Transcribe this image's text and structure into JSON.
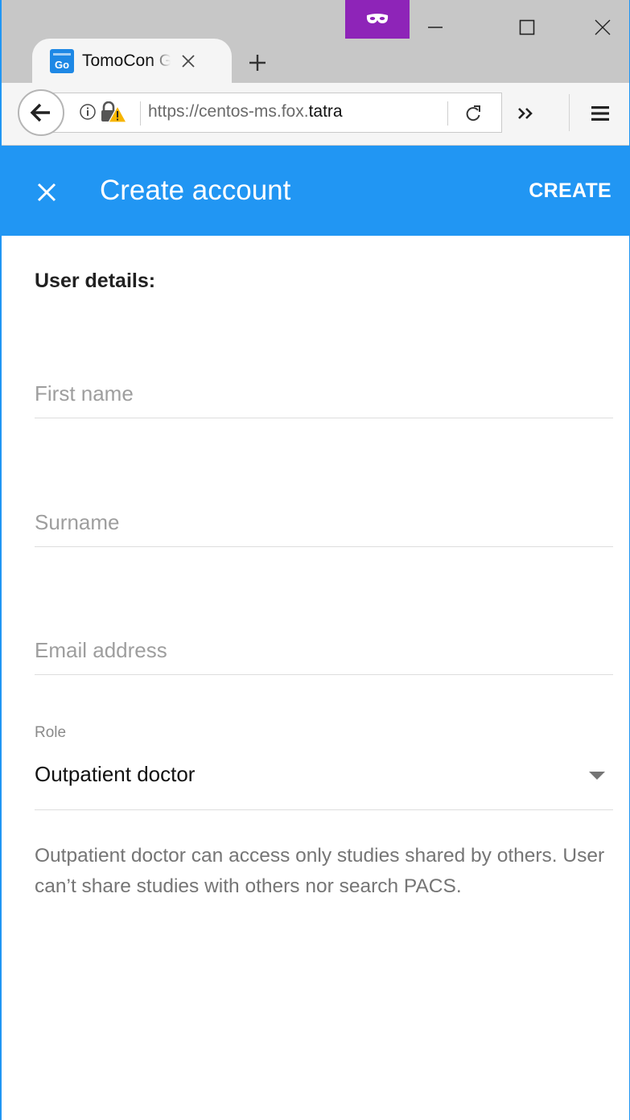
{
  "browser": {
    "tab": {
      "favicon_text": "Go",
      "title": "TomoCon GO",
      "title_visible": "TomoCon"
    },
    "url": {
      "prefix": "https://centos-ms.fox.",
      "host": "tatra"
    },
    "icons": {
      "private": "mask-icon",
      "back": "arrow-left-icon",
      "info": "info-circle-icon",
      "security": "lock-warning-icon",
      "reload": "reload-icon",
      "overflow": "double-chevron-right-icon",
      "menu": "hamburger-icon"
    },
    "colors": {
      "private_badge": "#8e24b8",
      "chrome": "#c7c7c7"
    }
  },
  "appbar": {
    "title": "Create account",
    "create_label": "CREATE",
    "color": "#2196f3"
  },
  "form": {
    "section_title": "User details:",
    "first_name": {
      "placeholder": "First name",
      "value": ""
    },
    "surname": {
      "placeholder": "Surname",
      "value": ""
    },
    "email": {
      "placeholder": "Email address",
      "value": ""
    },
    "role": {
      "label": "Role",
      "value": "Outpatient doctor",
      "help": "Outpatient doctor can access only studies shared by others. User can’t share studies with others nor search PACS."
    }
  }
}
